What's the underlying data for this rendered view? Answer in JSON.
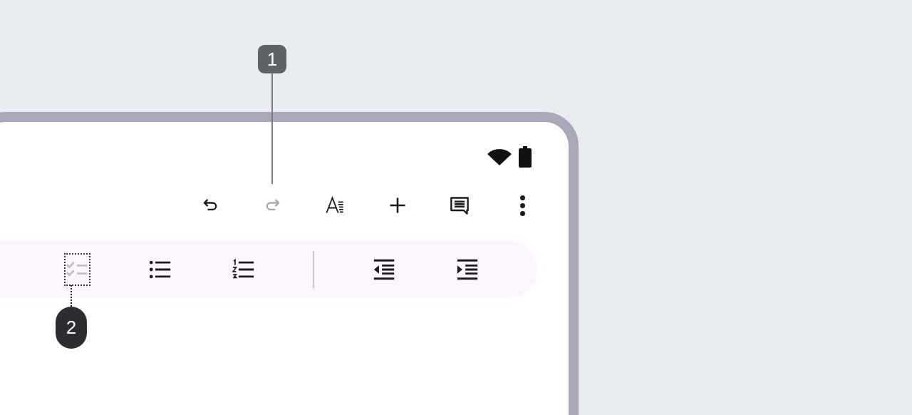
{
  "callouts": [
    {
      "label": "1",
      "kind": "solid"
    },
    {
      "label": "2",
      "kind": "dotted"
    }
  ],
  "status_bar": {
    "icons": [
      {
        "kind": "wifi"
      },
      {
        "kind": "battery"
      }
    ]
  },
  "top_toolbar": [
    {
      "kind": "undo",
      "disabled": false
    },
    {
      "kind": "redo",
      "disabled": true
    },
    {
      "kind": "text_format",
      "disabled": false
    },
    {
      "kind": "insert",
      "disabled": false
    },
    {
      "kind": "comment",
      "disabled": false
    },
    {
      "kind": "more",
      "disabled": false
    }
  ],
  "format_bar": [
    {
      "kind": "checklist",
      "disabled": true,
      "focused": true
    },
    {
      "kind": "bulleted_list",
      "disabled": false,
      "focused": false
    },
    {
      "kind": "numbered_list",
      "disabled": false,
      "focused": false
    },
    {
      "kind": "divider"
    },
    {
      "kind": "decrease_indent",
      "disabled": false,
      "focused": false
    },
    {
      "kind": "increase_indent",
      "disabled": false,
      "focused": false
    }
  ]
}
